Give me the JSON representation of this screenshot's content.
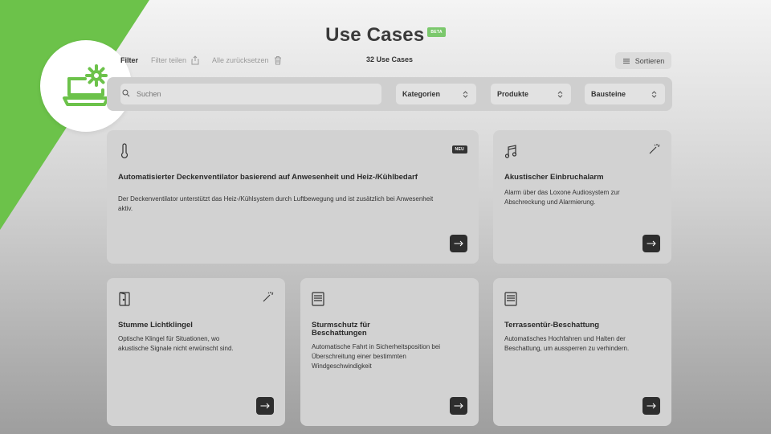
{
  "header": {
    "title": "Use Cases",
    "beta_label": "BETA"
  },
  "toolbar": {
    "filter_label": "Filter",
    "share_label": "Filter teilen",
    "reset_label": "Alle zurücksetzen",
    "count_label": "32 Use Cases",
    "sort_label": "Sortieren"
  },
  "search": {
    "placeholder": "Suchen"
  },
  "filters": [
    {
      "label": "Kategorien"
    },
    {
      "label": "Produkte"
    },
    {
      "label": "Bausteine"
    }
  ],
  "cards": [
    {
      "icon": "thermometer-icon",
      "badge": "NEU",
      "title": "Automatisierter Deckenventilator basierend auf Anwesenheit und Heiz-/Kühlbedarf",
      "description": "Der Deckenventilator unterstützt das Heiz-/Kühlsystem durch Luftbewegung und ist zusätzlich bei Anwesenheit aktiv."
    },
    {
      "icon": "music-note-icon",
      "corner_icon": "magic-wand-icon",
      "title": "Akustischer Einbruchalarm",
      "description": "Alarm über das Loxone Audiosystem zur Abschreckung und Alarmierung."
    },
    {
      "icon": "door-icon",
      "corner_icon": "magic-wand-icon",
      "title": "Stumme Lichtklingel",
      "description": "Optische Klingel für Situationen, wo akustische Signale nicht erwünscht sind."
    },
    {
      "icon": "shading-icon",
      "title": "Sturmschutz für Beschattungen",
      "description": "Automatische Fahrt in Sicherheitsposition bei Überschreitung einer bestimmten Windgeschwindigkeit"
    },
    {
      "icon": "shading-icon",
      "title": "Terrassentür-Beschattung",
      "description": "Automatisches Hochfahren und Halten der Beschattung, um aussperren zu verhindern."
    }
  ],
  "colors": {
    "accent_green": "#6cc24a",
    "button_dark": "#2e2e2e"
  }
}
